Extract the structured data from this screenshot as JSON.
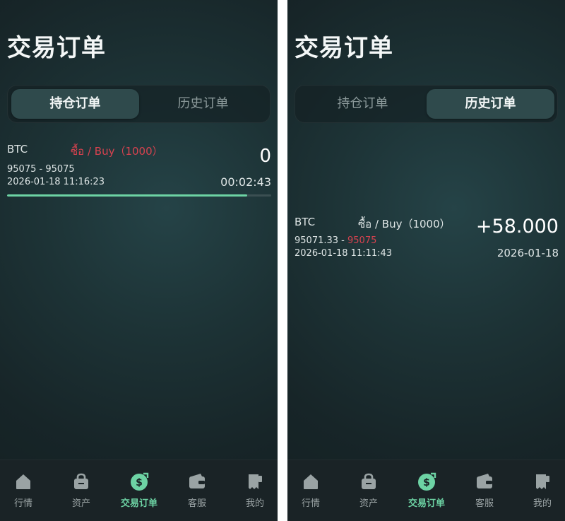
{
  "screens": [
    {
      "title": "交易订单",
      "tabs": [
        "持仓订单",
        "历史订单"
      ],
      "active_tab": 0,
      "order": {
        "symbol": "BTC",
        "side": "ซื้อ / Buy（1000）",
        "side_color": "#d7424f",
        "price_from": "95075",
        "price_sep": " - ",
        "price_to": "95075",
        "time": "2026-01-18 11:16:23",
        "amount": "0",
        "countdown": "00:02:43",
        "progress": 0.91
      }
    },
    {
      "title": "交易订单",
      "tabs": [
        "持仓订单",
        "历史订单"
      ],
      "active_tab": 1,
      "order": {
        "symbol": "BTC",
        "side": "ซื้อ / Buy（1000）",
        "side_color": "#dfe6e6",
        "price_from": "95071.33",
        "price_sep": " - ",
        "price_to": "95075",
        "price_to_color": "#d7424f",
        "time": "2026-01-18 11:11:43",
        "amount": "+58.000",
        "date": "2026-01-18"
      }
    }
  ],
  "tabbar": {
    "items": [
      {
        "label": "行情",
        "icon": "home-icon"
      },
      {
        "label": "资产",
        "icon": "bag-icon"
      },
      {
        "label": "交易订单",
        "icon": "dollar-coin-icon"
      },
      {
        "label": "客服",
        "icon": "wallet-card-icon"
      },
      {
        "label": "我的",
        "icon": "receipt-icon"
      }
    ],
    "active_index": 2,
    "active_color": "#6dd3a4",
    "inactive_color": "#9aa3a4"
  }
}
